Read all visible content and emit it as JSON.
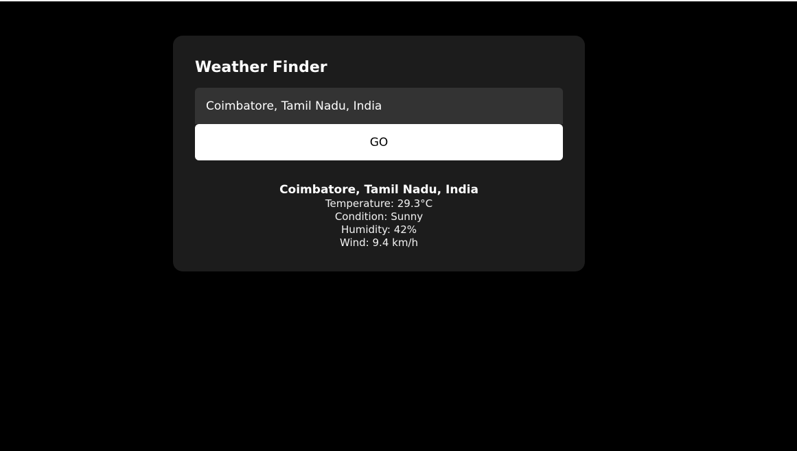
{
  "app": {
    "title": "Weather Finder"
  },
  "search": {
    "value": "Coimbatore, Tamil Nadu, India",
    "button_label": "GO"
  },
  "result": {
    "location": "Coimbatore, Tamil Nadu, India",
    "temperature": "Temperature: 29.3°C",
    "condition": "Condition: Sunny",
    "humidity": "Humidity: 42%",
    "wind": "Wind: 9.4 km/h"
  },
  "colors": {
    "page_background": "#000000",
    "card_background": "#1c1c1c",
    "input_background": "#333333",
    "button_background": "#ffffff",
    "text": "#ffffff"
  }
}
